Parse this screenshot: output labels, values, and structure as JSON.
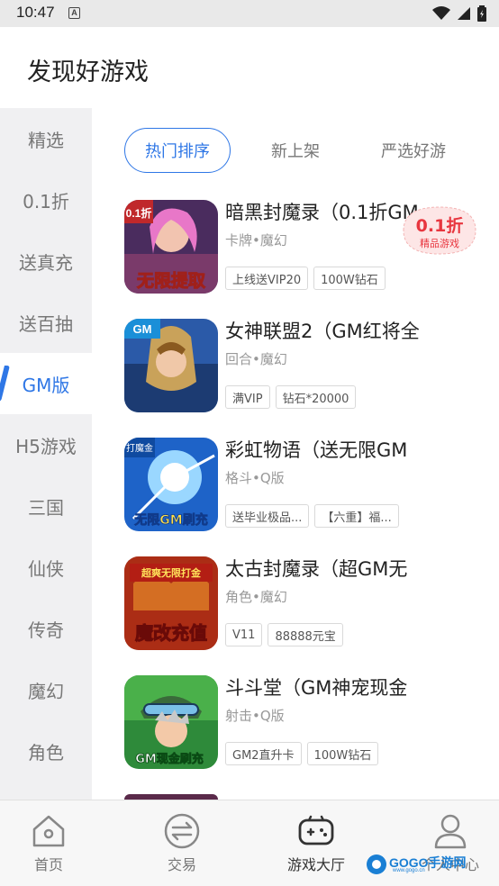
{
  "status_bar": {
    "time": "10:47",
    "notification_icon": "A"
  },
  "header": {
    "title": "发现好游戏"
  },
  "sidebar": {
    "items": [
      {
        "label": "精选"
      },
      {
        "label": "0.1折"
      },
      {
        "label": "送真充"
      },
      {
        "label": "送百抽"
      },
      {
        "label": "GM版",
        "active": true
      },
      {
        "label": "H5游戏"
      },
      {
        "label": "三国"
      },
      {
        "label": "仙侠"
      },
      {
        "label": "传奇"
      },
      {
        "label": "魔幻"
      },
      {
        "label": "角色"
      }
    ]
  },
  "tabs": [
    {
      "label": "热门排序",
      "active": true
    },
    {
      "label": "新上架"
    },
    {
      "label": "严选好游"
    }
  ],
  "games": [
    {
      "name": "暗黑封魔录（0.1折GM",
      "meta": "卡牌•魔幻",
      "tags": [
        "上线送VIP20",
        "100W钻石"
      ],
      "cover_text": "无限提取",
      "cover_corner": "0.1折"
    },
    {
      "name": "女神联盟2（GM红将全",
      "meta": "回合•魔幻",
      "tags": [
        "满VIP",
        "钻石*20000"
      ],
      "cover_text": "",
      "cover_corner": "GM"
    },
    {
      "name": "彩虹物语（送无限GM",
      "meta": "格斗•Q版",
      "tags": [
        "送毕业极品...",
        "【六重】福..."
      ],
      "cover_text": "无限GM刷充",
      "cover_corner": "打魔金"
    },
    {
      "name": "太古封魔录（超GM无",
      "meta": "角色•魔幻",
      "tags": [
        "V11",
        "88888元宝"
      ],
      "cover_text": "魔改充值",
      "cover_corner": "超爽无限打金"
    },
    {
      "name": "斗斗堂（GM神宠现金",
      "meta": "射击•Q版",
      "tags": [
        "GM2直升卡",
        "100W钻石"
      ],
      "cover_text": "GM现金刷充",
      "cover_corner": ""
    }
  ],
  "discount_badge": {
    "main": "0.1折",
    "sub": "精品游戏"
  },
  "bottom_nav": [
    {
      "label": "首页",
      "icon": "home-icon"
    },
    {
      "label": "交易",
      "icon": "trade-icon"
    },
    {
      "label": "游戏大厅",
      "icon": "gamepad-icon",
      "active": true
    },
    {
      "label": "个人中心",
      "icon": "user-icon"
    }
  ],
  "watermark": {
    "text": "GOGO手游网",
    "sub": "www.gogo.cn"
  },
  "colors": {
    "accent": "#2f77e6",
    "discount": "#e8363f",
    "sidebar_bg": "#f0f0f2"
  }
}
